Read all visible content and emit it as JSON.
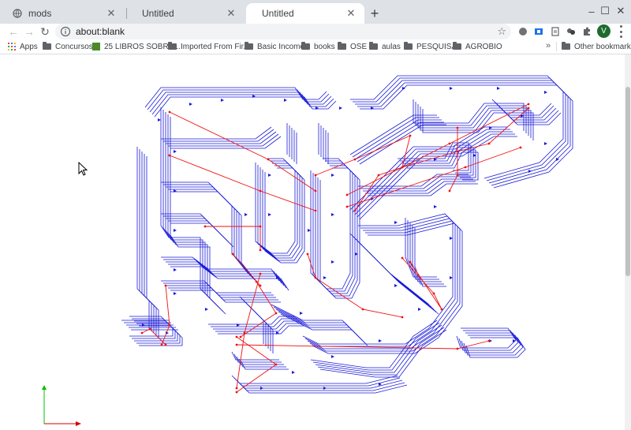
{
  "tabs": [
    {
      "title": "mods",
      "icon": "globe-icon",
      "active": false
    },
    {
      "title": "Untitled",
      "icon": "",
      "active": false
    },
    {
      "title": "Untitled",
      "icon": "",
      "active": true
    }
  ],
  "window": {
    "minimize": "–",
    "maximize": "☐",
    "close": "✕",
    "new_tab": "+"
  },
  "toolbar": {
    "back": "←",
    "forward": "→",
    "reload": "↻",
    "url": "about:blank",
    "avatar_letter": "V"
  },
  "bookmarks": {
    "items": [
      {
        "label": "Apps",
        "type": "apps"
      },
      {
        "label": "Concursos",
        "type": "folder"
      },
      {
        "label": "25 LIBROS SOBRE...",
        "type": "book"
      },
      {
        "label": "Imported From Fir...",
        "type": "folder"
      },
      {
        "label": "Basic Income",
        "type": "folder"
      },
      {
        "label": "books",
        "type": "folder"
      },
      {
        "label": "OSE",
        "type": "folder"
      },
      {
        "label": "aulas",
        "type": "folder"
      },
      {
        "label": "PESQUISA",
        "type": "folder"
      },
      {
        "label": "AGROBIO",
        "type": "folder"
      }
    ],
    "overflow": "»",
    "other": "Other bookmarks"
  },
  "colors": {
    "toolpath": "#1a1ad8",
    "jog_moves": "#ee1111",
    "axis_x": "#d40000",
    "axis_y": "#00c000",
    "tabstrip": "#dee1e6"
  }
}
